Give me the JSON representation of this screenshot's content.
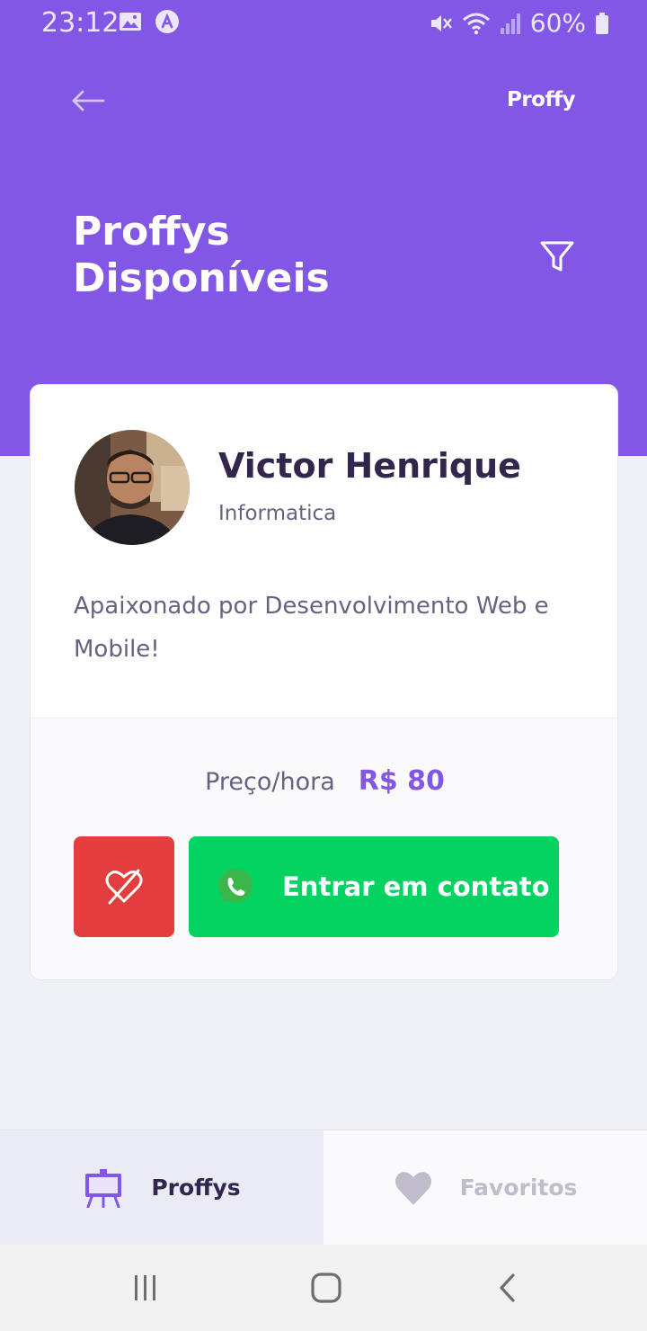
{
  "status_bar": {
    "time": "23:12",
    "battery": "60%",
    "icons": [
      "image-icon",
      "app-badge-icon",
      "mute-icon",
      "wifi-icon",
      "signal-icon",
      "battery-icon"
    ]
  },
  "header": {
    "logo": "Proffy",
    "title": "Proffys\nDisponíveis",
    "back_icon": "arrow-left-icon",
    "filter_icon": "filter-icon",
    "background": "#8257e5"
  },
  "teacher": {
    "name": "Victor Henrique",
    "subject": "Informatica",
    "bio": "Apaixonado por Desenvolvimento Web e Mobile!",
    "price_label": "Preço/hora",
    "price": "R$ 80",
    "contact_label": "Entrar em contato",
    "favorite_state": "favorited",
    "colors": {
      "unfavorite": "#e33d3d",
      "contact": "#04d361",
      "price": "#8257e5"
    }
  },
  "tabs": [
    {
      "label": "Proffys",
      "icon": "easel-icon",
      "active": true
    },
    {
      "label": "Favoritos",
      "icon": "heart-icon",
      "active": false
    }
  ],
  "nav": {
    "icons": [
      "recents-icon",
      "home-icon",
      "back-icon"
    ]
  }
}
